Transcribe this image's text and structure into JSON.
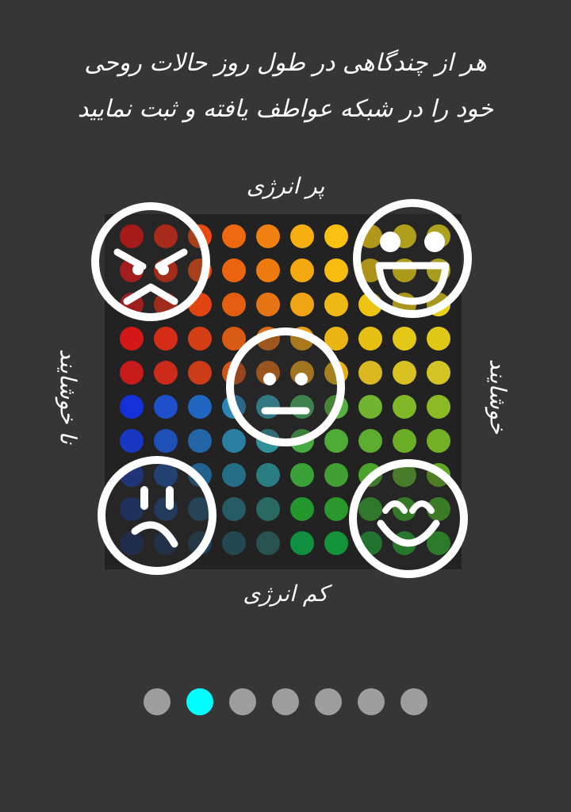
{
  "instructions": {
    "line1": "هر از چندگاهی در طول روز حالات روحی",
    "line2": "خود را در شبکه عواطف یافته و ثبت نمایید"
  },
  "axes": {
    "top": "پر انرژی",
    "bottom": "کم انرژی",
    "left": "نا خوشایند",
    "right": "خوشایند"
  },
  "mood_grid": {
    "columns": 10,
    "rows": 10,
    "colors": [
      [
        "#e81010",
        "#e82810",
        "#ea4a10",
        "#ee6810",
        "#f08010",
        "#f6ae10",
        "#f8c010",
        "#f8d010",
        "#f4dc10",
        "#f0e018"
      ],
      [
        "#e41414",
        "#e42c10",
        "#e84a10",
        "#ec6410",
        "#ee7a10",
        "#f4a810",
        "#f6bc10",
        "#f4c810",
        "#f0d414",
        "#ecd818"
      ],
      [
        "#dc1818",
        "#de2c14",
        "#e04410",
        "#e45e12",
        "#e67412",
        "#eea414",
        "#f0b814",
        "#eec414",
        "#eccc14",
        "#e8d018"
      ],
      [
        "#d41818",
        "#d42c16",
        "#d43e14",
        "#d85a14",
        "#dc6e14",
        "#e8a014",
        "#eab414",
        "#e8c014",
        "#e4c818",
        "#e0c818"
      ],
      [
        "#c81c1c",
        "#cc2a1a",
        "#cc3c18",
        "#d05418",
        "#d46a18",
        "#e09a18",
        "#e4b018",
        "#dcb820",
        "#d8c020",
        "#d4c424"
      ],
      [
        "#1430d8",
        "#1e50cc",
        "#2066c0",
        "#2c86b8",
        "#34a0b0",
        "#4ab060",
        "#58b040",
        "#70b430",
        "#80b828",
        "#8cba24"
      ],
      [
        "#1838c4",
        "#1e50b8",
        "#2266a8",
        "#2a7ea0",
        "#2e9098",
        "#48aa44",
        "#50aa38",
        "#5cac30",
        "#6aae28",
        "#74b024"
      ],
      [
        "#1a389e",
        "#1e4c96",
        "#22608e",
        "#266e88",
        "#2a7e82",
        "#3aa038",
        "#40a034",
        "#4aa42c",
        "#56a628",
        "#60a824"
      ],
      [
        "#1a3478",
        "#1e4272",
        "#22506c",
        "#265c66",
        "#2a6862",
        "#24962e",
        "#2a982c",
        "#32a02a",
        "#3aa226",
        "#42a424"
      ],
      [
        "#1a2c58",
        "#1c3456",
        "#203e54",
        "#244852",
        "#285250",
        "#109040",
        "#149438",
        "#1c9832",
        "#24a02c",
        "#2ca428"
      ]
    ]
  },
  "faces": [
    "angry-face-icon",
    "grinning-face-icon",
    "neutral-face-icon",
    "sad-face-icon",
    "happy-face-icon"
  ],
  "pagination": {
    "count": 7,
    "active_index": 1,
    "active_color": "#00ffff",
    "inactive_color": "#9e9e9e"
  }
}
